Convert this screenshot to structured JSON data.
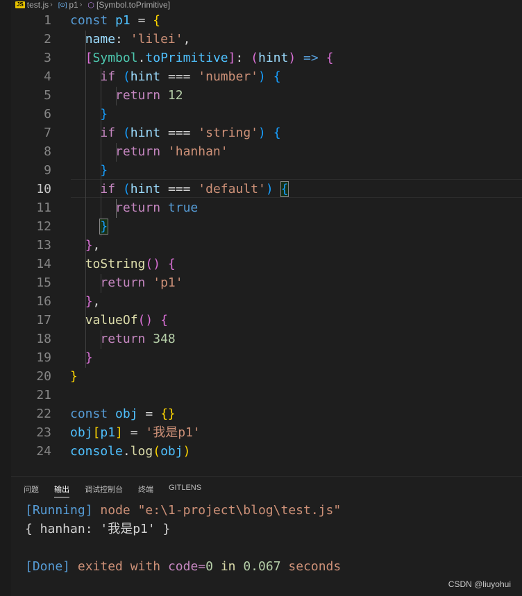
{
  "breadcrumb": {
    "file_badge": "JS",
    "file": "test.js",
    "var": "p1",
    "symbol": "[Symbol.toPrimitive]"
  },
  "editor": {
    "active_line": 10,
    "lines": [
      {
        "n": "1"
      },
      {
        "n": "2"
      },
      {
        "n": "3"
      },
      {
        "n": "4"
      },
      {
        "n": "5"
      },
      {
        "n": "6"
      },
      {
        "n": "7"
      },
      {
        "n": "8"
      },
      {
        "n": "9"
      },
      {
        "n": "10"
      },
      {
        "n": "11"
      },
      {
        "n": "12"
      },
      {
        "n": "13"
      },
      {
        "n": "14"
      },
      {
        "n": "15"
      },
      {
        "n": "16"
      },
      {
        "n": "17"
      },
      {
        "n": "18"
      },
      {
        "n": "19"
      },
      {
        "n": "20"
      },
      {
        "n": "21"
      },
      {
        "n": "22"
      },
      {
        "n": "23"
      },
      {
        "n": "24"
      }
    ],
    "tokens": {
      "l1": [
        "const",
        "p1",
        "=",
        "{"
      ],
      "l2": [
        "name",
        ":",
        "'lilei'",
        ","
      ],
      "l3": [
        "[",
        "Symbol",
        ".",
        "toPrimitive",
        "]",
        ":",
        "(",
        "hint",
        ")",
        "=>",
        "{"
      ],
      "l4": [
        "if",
        "(",
        "hint",
        "===",
        "'number'",
        ")",
        "{"
      ],
      "l5": [
        "return",
        "12"
      ],
      "l6": [
        "}"
      ],
      "l7": [
        "if",
        "(",
        "hint",
        "===",
        "'string'",
        ")",
        "{"
      ],
      "l8": [
        "return",
        "'hanhan'"
      ],
      "l9": [
        "}"
      ],
      "l10": [
        "if",
        "(",
        "hint",
        "===",
        "'default'",
        ")",
        "{"
      ],
      "l11": [
        "return",
        "true"
      ],
      "l12": [
        "}"
      ],
      "l13": [
        "}",
        ","
      ],
      "l14": [
        "toString",
        "()",
        "{"
      ],
      "l15": [
        "return",
        "'p1'"
      ],
      "l16": [
        "}",
        ","
      ],
      "l17": [
        "valueOf",
        "()",
        "{"
      ],
      "l18": [
        "return",
        "348"
      ],
      "l19": [
        "}"
      ],
      "l20": [
        "}"
      ],
      "l22": [
        "const",
        "obj",
        "=",
        "{}"
      ],
      "l23": [
        "obj",
        "[",
        "p1",
        "]",
        "=",
        "'我是p1'"
      ],
      "l24": [
        "console",
        ".",
        "log",
        "(",
        "obj",
        ")"
      ]
    }
  },
  "panel": {
    "tabs": [
      "问题",
      "输出",
      "调试控制台",
      "终端",
      "GITLENS"
    ],
    "active_tab": "输出",
    "output": {
      "running_tag": "[Running]",
      "running_cmd": "node \"e:\\1-project\\blog\\test.js\"",
      "result": "{ hanhan: '我是p1' }",
      "done_tag": "[Done]",
      "exited_with": "exited with",
      "code_label": "code=",
      "code_value": "0",
      "in_word": "in",
      "elapsed": "0.067",
      "seconds": "seconds"
    }
  },
  "watermark": "CSDN @liuyohui",
  "colors": {
    "background": "#1e1e1e",
    "keyword": "#569cd6",
    "control": "#c586c0",
    "string": "#ce9178",
    "number": "#b5cea8",
    "function": "#dcdcaa",
    "property": "#9cdcfe",
    "constant": "#4fc1ff",
    "bracket_1": "#ffd700",
    "bracket_2": "#da70d6",
    "bracket_3": "#179fff"
  }
}
